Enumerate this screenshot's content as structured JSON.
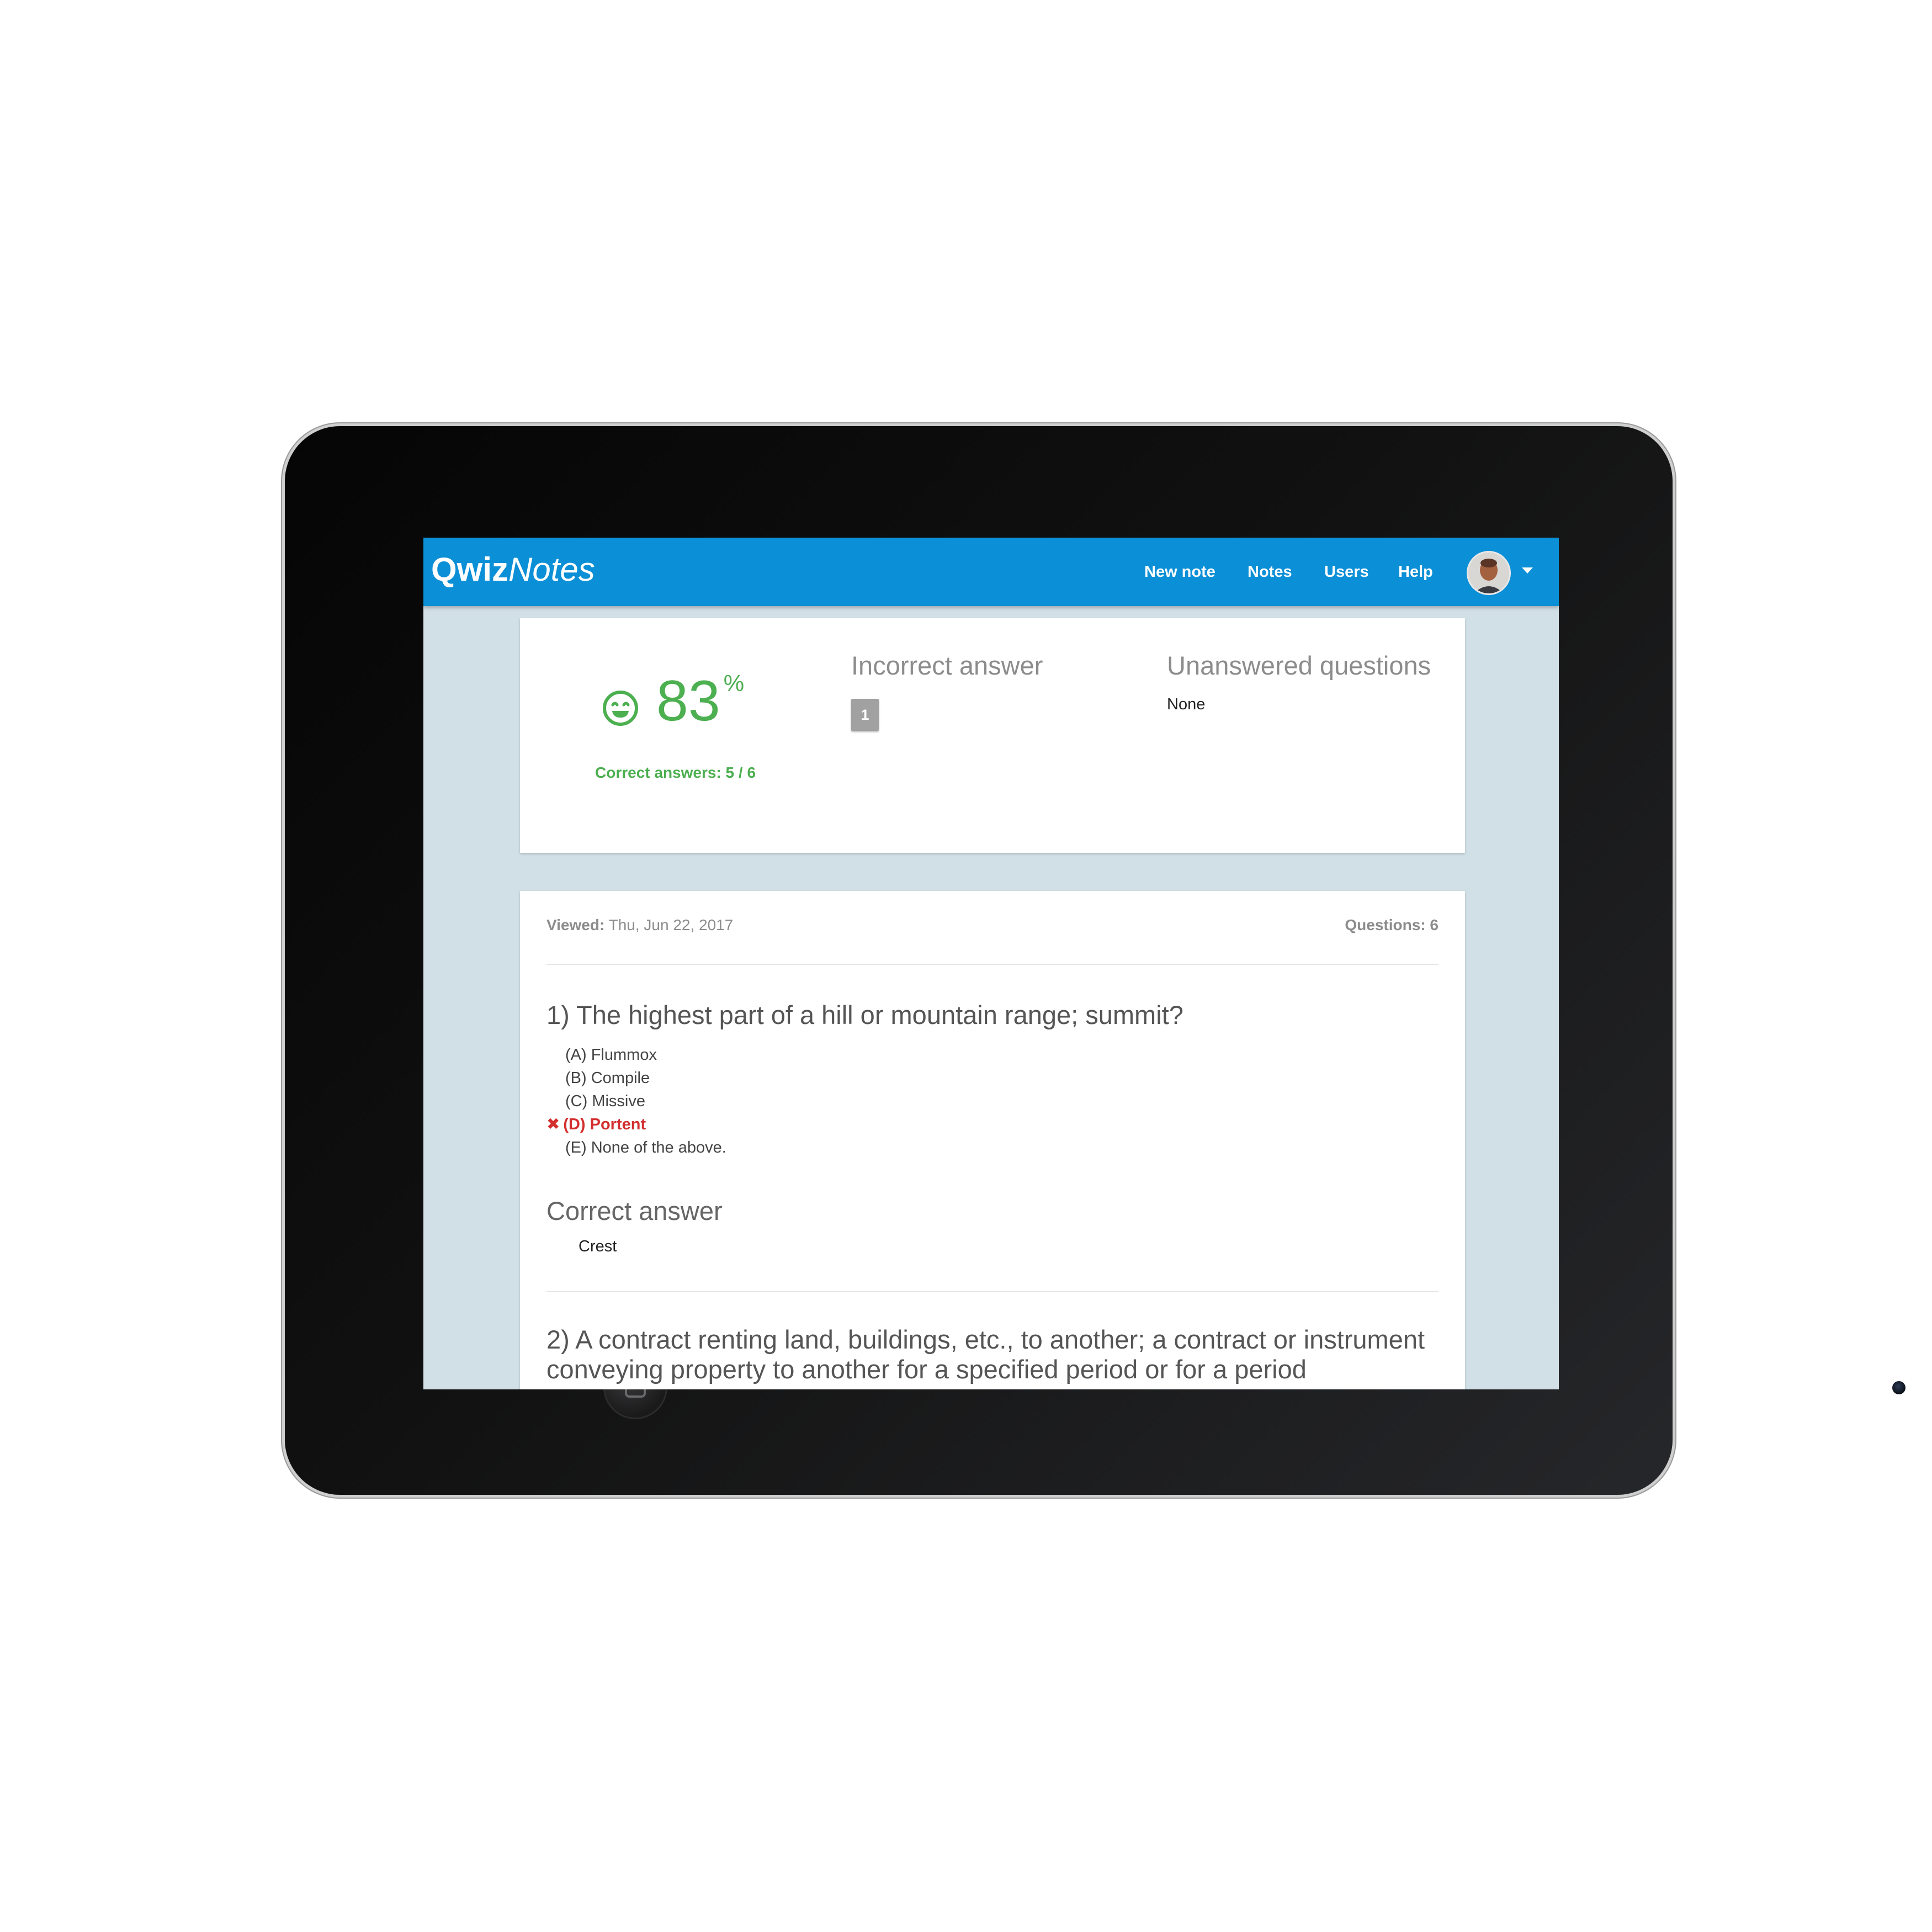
{
  "app": {
    "logo_bold": "Qwiz",
    "logo_italic": "Notes",
    "nav": [
      "New note",
      "Notes",
      "Users",
      "Help"
    ],
    "brand_color": "#0b8fd6",
    "background_color": "#d1dfe7"
  },
  "summary": {
    "score_icon": "smiley-face-icon",
    "score_value": "83",
    "score_unit": "%",
    "correct_answers": "Correct answers: 5 / 6",
    "score_color": "#4caf50",
    "incorrect_title": "Incorrect answer",
    "incorrect_badge": "1",
    "unanswered_title": "Unanswered questions",
    "unanswered_value": "None"
  },
  "detail": {
    "viewed_label": "Viewed:",
    "viewed_date": "Thu, Jun 22, 2017",
    "questions_label": "Questions: 6",
    "question_1": {
      "text": "1) The highest part of a hill or mountain range; summit?",
      "options": [
        {
          "label": "(A) Flummox"
        },
        {
          "label": "(B) Compile"
        },
        {
          "label": "(C) Missive"
        },
        {
          "label": "(D) Portent",
          "status": "incorrect",
          "mark": "✖"
        },
        {
          "label": "(E) None of the above."
        }
      ],
      "correct_answer_title": "Correct answer",
      "correct_answer": "Crest"
    },
    "question_2": {
      "text": "2) A contract renting land, buildings, etc., to another; a contract or instrument conveying property to another for a specified period or for a period"
    }
  }
}
